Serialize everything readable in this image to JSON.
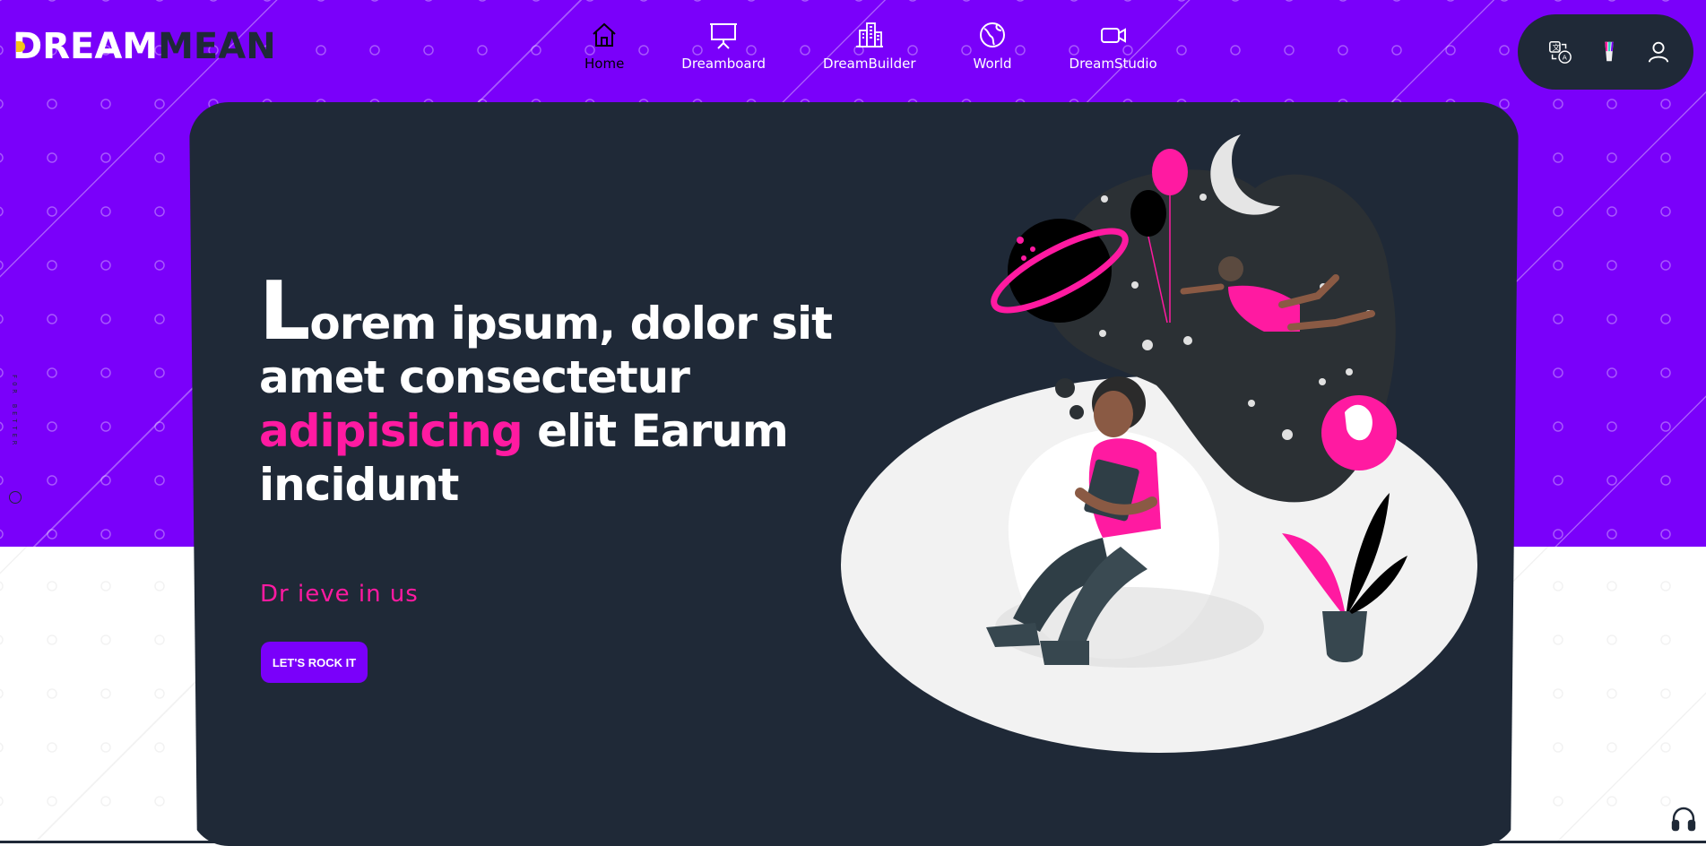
{
  "brand": {
    "logo_part1": "DREAM",
    "logo_part2": "EAN"
  },
  "nav": {
    "items": [
      {
        "label": "Home",
        "icon": "home-icon",
        "active": true
      },
      {
        "label": "Dreamboard",
        "icon": "presentation-board-icon"
      },
      {
        "label": "DreamBuilder",
        "icon": "buildings-icon"
      },
      {
        "label": "World",
        "icon": "globe-icon"
      },
      {
        "label": "DreamStudio",
        "icon": "video-camera-icon"
      }
    ]
  },
  "utility": {
    "icons": [
      "translate-icon",
      "theme-palette-icon",
      "user-icon"
    ]
  },
  "side_text": "FOR BETTER",
  "hero": {
    "title_dropcap": "L",
    "title_line1_rest": "orem ipsum, dolor sit",
    "title_line2": "amet consectetur",
    "title_accent": "adipisicing",
    "title_line3_rest": " elit Earum",
    "title_line4": "incidunt",
    "tagline": "Dr ieve in us",
    "cta_label": "LET'S ROCK IT"
  },
  "colors": {
    "purple": "#7a00fa",
    "dark": "#1f2937",
    "pink": "#ff1aa1"
  },
  "support": {
    "icon": "headphones-icon"
  }
}
